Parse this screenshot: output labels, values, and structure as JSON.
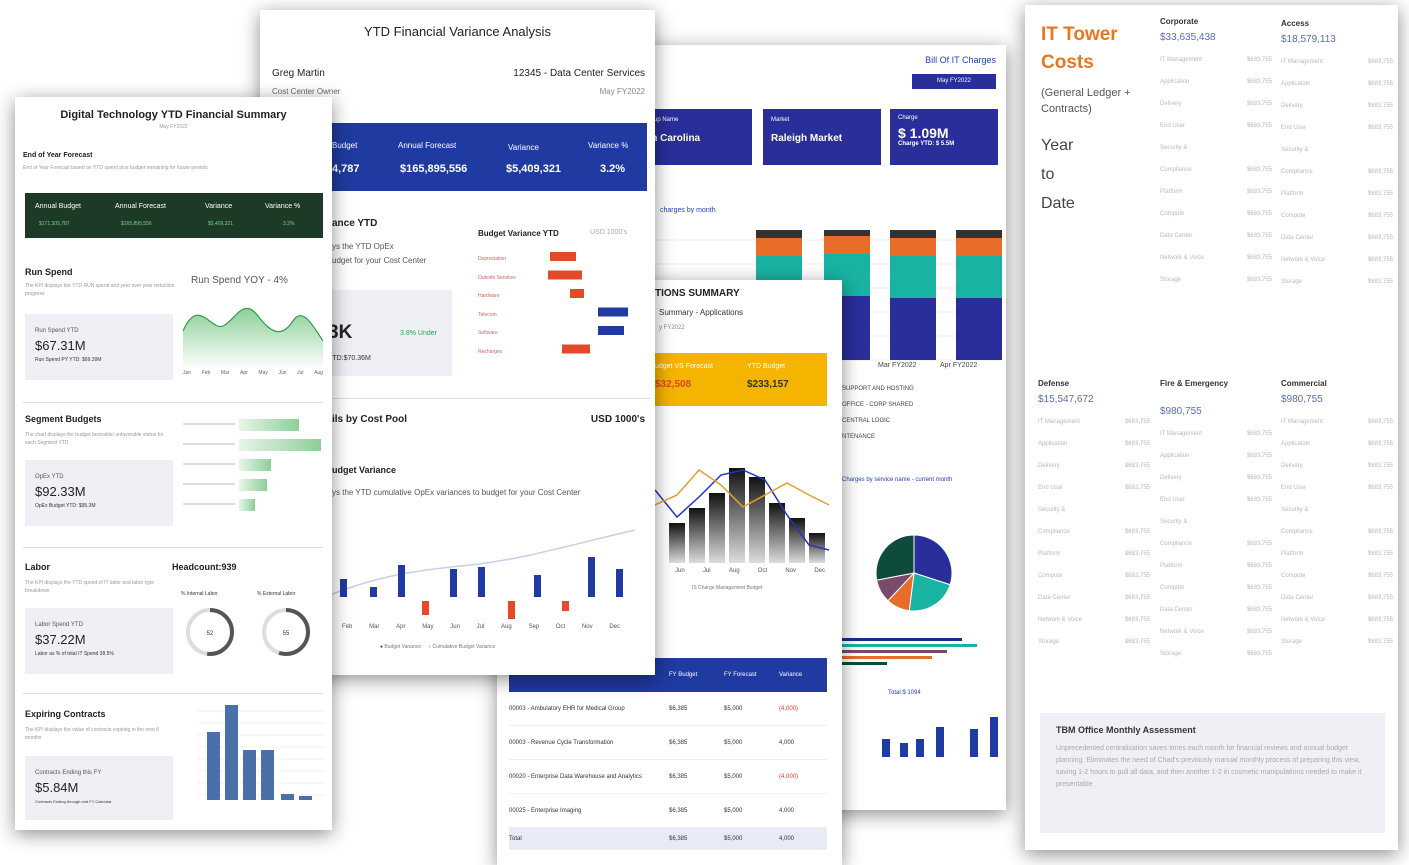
{
  "page1": {
    "title": "Digital Technology YTD Financial Summary",
    "subtitle": "May FY2022",
    "forecast_heading": "End of Year Forecast",
    "forecast_desc": "End of Year Forecast based on YTD spend plus budget remaining for future periods",
    "headers": [
      "Annual Budget",
      "Annual Forecast",
      "Variance",
      "Variance %"
    ],
    "values": [
      "$171,305,787",
      "$165,895,556",
      "$5,409,321",
      "3.2%"
    ],
    "run_title": "Run Spend",
    "run_desc": "The KPI displays the YTD RUN spend and year over year reduction progress",
    "run_label": "Run Spend YTD",
    "run_value": "$67.31M",
    "run_py": "Run Spend PY YTD: $69.39M",
    "run_chart_title": "Run Spend YOY - 4%",
    "run_months": [
      "Jan",
      "Feb",
      "Mar",
      "Apr",
      "May",
      "Jun",
      "Jul",
      "Aug"
    ],
    "seg_title": "Segment Budgets",
    "seg_desc": "The chart displays the budget favorable/ unfavorable status for each Segment YTD",
    "seg_label": "OpEx YTD",
    "seg_value": "$92.33M",
    "seg_budget": "OpEx Budget YTD: $95.3M",
    "labor_title": "Labor",
    "labor_desc": "The KPI displays the YTD spend of IT labor and labor type breakdown",
    "headcount": "Headcount:939",
    "internal_label": "% Internal Labor",
    "external_label": "% External Labor",
    "internal_value": "52",
    "external_value": "55",
    "labor_label": "Labor Spend YTD",
    "labor_value": "$37.22M",
    "labor_note": "Labor as % of total IT Spend 38.5%",
    "exp_title": "Expiring Contracts",
    "exp_desc": "The KPI displays the value of contracts expiring in the next 6 months",
    "exp_label": "Contracts Ending this FY",
    "exp_value": "$5.84M",
    "exp_note": "Contracts Ending through end FY Calendar"
  },
  "page2": {
    "title": "YTD Financial Variance Analysis",
    "owner_name": "Greg Martin",
    "owner_role": "Cost Center Owner",
    "center": "12345 - Data Center Services",
    "period": "May FY2022",
    "headers": [
      "Budget",
      "Annual Forecast",
      "Variance",
      "Variance %"
    ],
    "values": [
      "4,787",
      "$165,895,556",
      "$5,409,321",
      "3.2%"
    ],
    "ytd_title": "ance YTD",
    "ytd_desc1": "ys the YTD OpEx",
    "ytd_desc2": "udget for your Cost Center",
    "big_value": "3K",
    "under": "3.8% Under",
    "ytd_sub": "et YTD:$70.36M",
    "bv_title": "Budget Variance YTD",
    "bv_unit": "USD 1000's",
    "bv_cats": [
      "Depreciation",
      "Outside Services",
      "Hardware",
      "Telecom",
      "Software",
      "Recharges"
    ],
    "pool_title": "ils by Cost Pool",
    "pool_unit": "USD 1000's",
    "var_title": "udget Variance",
    "var_desc": "ys the YTD cumulative OpEx variances to budget for your Cost Center",
    "months": [
      "Feb",
      "Mar",
      "Apr",
      "May",
      "Jun",
      "Jul",
      "Aug",
      "Sep",
      "Oct",
      "Nov",
      "Dec"
    ],
    "legend": [
      "Budget Variance",
      "Cumulative Budget Variance"
    ]
  },
  "page3": {
    "link": "Bill Of IT Charges",
    "badge": "May FY2022",
    "tile1_label": "Group Name",
    "tile1_value": "rth Carolina",
    "tile2_label": "Market",
    "tile2_value": "Raleigh Market",
    "tile3_label": "Charge",
    "tile3_value": "$ 1.09M",
    "tile3_sub": "Charge YTD: $ 5.5M",
    "chart_title": "charges by month",
    "months": [
      "Mar FY2022",
      "Apr FY2022"
    ],
    "legend": [
      "SUPPORT AND HOSTING",
      "OFFICE - CORP SHARED",
      "CENTRAL LOGIC",
      "NTENANCE"
    ],
    "pie_title": "Charges by service name - current month",
    "total": "Total $ 1094"
  },
  "page4": {
    "title": "TIONS SUMMARY",
    "subtitle": "Summary - Applications",
    "period": "y FY2022",
    "kpi1_label": "udget VS Forecast",
    "kpi1_value": "$32,508",
    "kpi2_label": "YTD Budget",
    "kpi2_value": "$233,157",
    "months": [
      "Jun",
      "Jul",
      "Aug",
      "Oct",
      "Nov",
      "Dec"
    ],
    "chart_legend": "IS Charge   Management Budget",
    "table_headers": [
      "",
      "FY Budget",
      "FY Forecast",
      "Variance"
    ],
    "rows": [
      [
        "00003 - Ambulatory EHR for Medical Group",
        "$6,385",
        "$5,000",
        "(4,000)"
      ],
      [
        "00003 - Revenue Cycle Transformation",
        "$6,385",
        "$5,000",
        "4,000"
      ],
      [
        "00020 - Enterprise Data Warehouse and Analytics",
        "$6,385",
        "$5,000",
        "(4,000)"
      ],
      [
        "00025 - Enterprise Imaging",
        "$6,385",
        "$5,000",
        "4,000"
      ],
      [
        "Total",
        "$6,385",
        "$5,000",
        "4,000"
      ]
    ]
  },
  "page5": {
    "title_line1": "IT Tower",
    "title_line2": "Costs",
    "subtitle": "(General Ledger + Contracts)",
    "ytd_line1": "Year",
    "ytd_line2": "to",
    "ytd_line3": "Date",
    "towers": [
      {
        "name": "Corporate",
        "value": "$33,635,438"
      },
      {
        "name": "Access",
        "value": "$18,579,113"
      },
      {
        "name": "Defense",
        "value": "$15,547,672"
      },
      {
        "name": "Fire & Emergency",
        "value": "$980,755"
      },
      {
        "name": "Commercial",
        "value": "$980,755"
      }
    ],
    "items": [
      "IT Management",
      "Application",
      "Delivery",
      "End User",
      "Security &",
      "Compliance",
      "Platform",
      "Compute",
      "Data Center",
      "Network & Voice",
      "Storage"
    ],
    "amount": "$683,755",
    "tbm_title": "TBM Office Monthly Assessment",
    "tbm_text": "Unprecedented centralization saves times each month for financial reviews and annual budget planning. Eliminates the need of Chad's previously manual monthly process of preparing this view, saving 1-2 hours to pull all data, and then another 1-2 in cosmetic manipulations needed to make it presentable"
  }
}
